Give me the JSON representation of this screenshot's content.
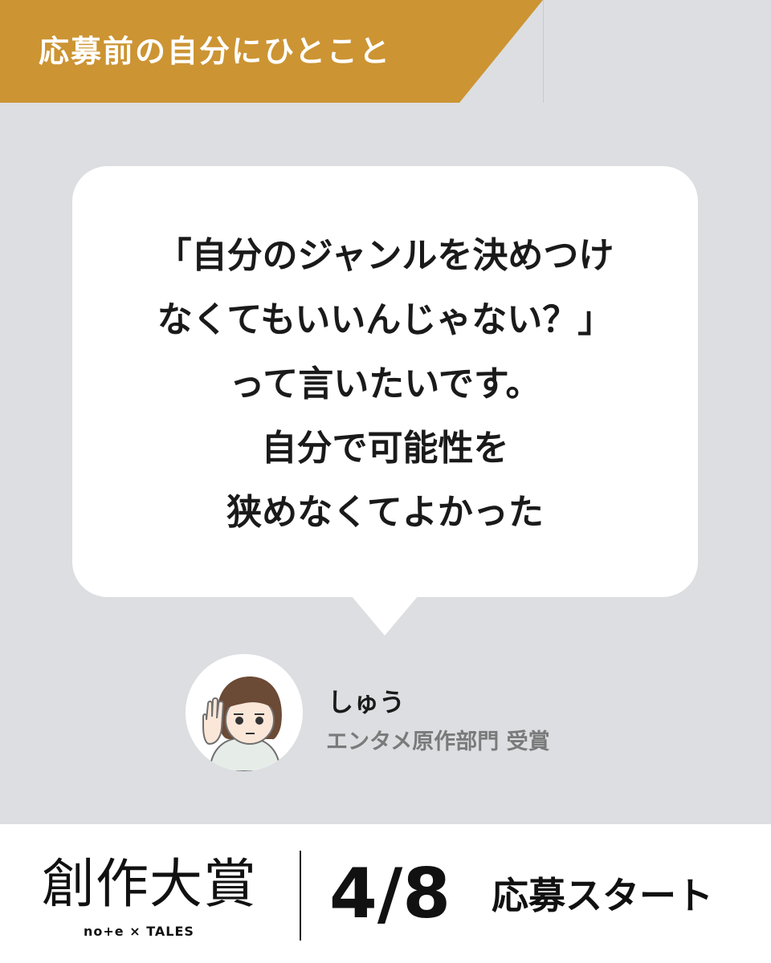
{
  "header": {
    "title": "応募前の自分にひとこと"
  },
  "quote": {
    "lines": [
      "「自分のジャンルを決めつけ",
      "なくてもいいんじゃない？」",
      "って言いたいです。",
      "自分で可能性を",
      "狭めなくてよかった"
    ]
  },
  "author": {
    "name": "しゅう",
    "award": "エンタメ原作部門 受賞",
    "avatar_icon": "illustrated-avatar-icon"
  },
  "footer": {
    "logo_main": "創作大賞",
    "logo_sub": "no+e × TALES",
    "date": "4/8",
    "start_text": "応募スタート"
  },
  "colors": {
    "banner": "#cc9433",
    "background": "#dcdee1",
    "bubble": "#ffffff",
    "text": "#1a1a1a",
    "award_text": "#7a7a7a"
  }
}
